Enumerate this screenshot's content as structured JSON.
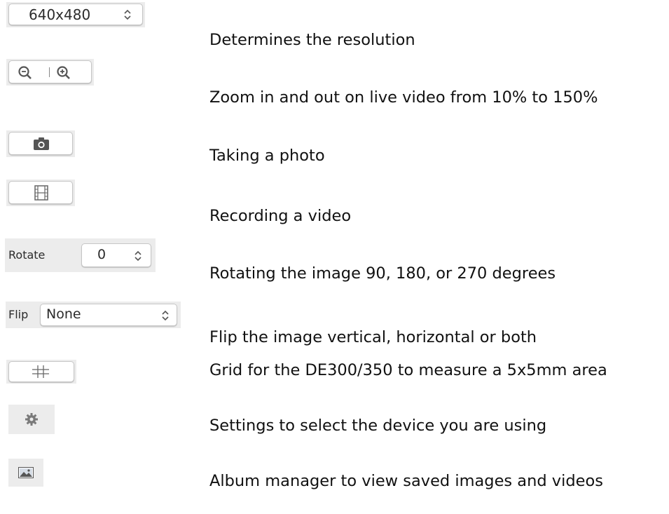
{
  "rows": [
    {
      "control": {
        "value": "640x480",
        "icon": "up-down-chevron-icon"
      },
      "description": "Determines the resolution"
    },
    {
      "control": {
        "icons": [
          "zoom-out-icon",
          "zoom-in-icon"
        ]
      },
      "description": "Zoom in and out on live video from 10% to 150%"
    },
    {
      "control": {
        "icon": "camera-icon"
      },
      "description": "Taking a photo"
    },
    {
      "control": {
        "icon": "film-icon"
      },
      "description": "Recording a video"
    },
    {
      "control": {
        "label": "Rotate",
        "value": "0",
        "icon": "up-down-chevron-icon"
      },
      "description": "Rotating the image 90, 180, or 270 degrees"
    },
    {
      "control": {
        "label": "Flip",
        "value": "None",
        "icon": "up-down-chevron-icon"
      },
      "description": "Flip the image vertical, horizontal or both"
    },
    {
      "control": {
        "icon": "grid-icon"
      },
      "description": "Grid for the DE300/350 to measure a 5x5mm area"
    },
    {
      "control": {
        "icon": "gear-icon"
      },
      "description": "Settings to select the device you are using"
    },
    {
      "control": {
        "icon": "image-icon"
      },
      "description": "Album manager to view saved images and videos"
    }
  ],
  "colors": {
    "strip": "#ececec",
    "button": "#ffffff",
    "border": "#c6c6c6",
    "icon": "#555555",
    "text": "#111111"
  }
}
